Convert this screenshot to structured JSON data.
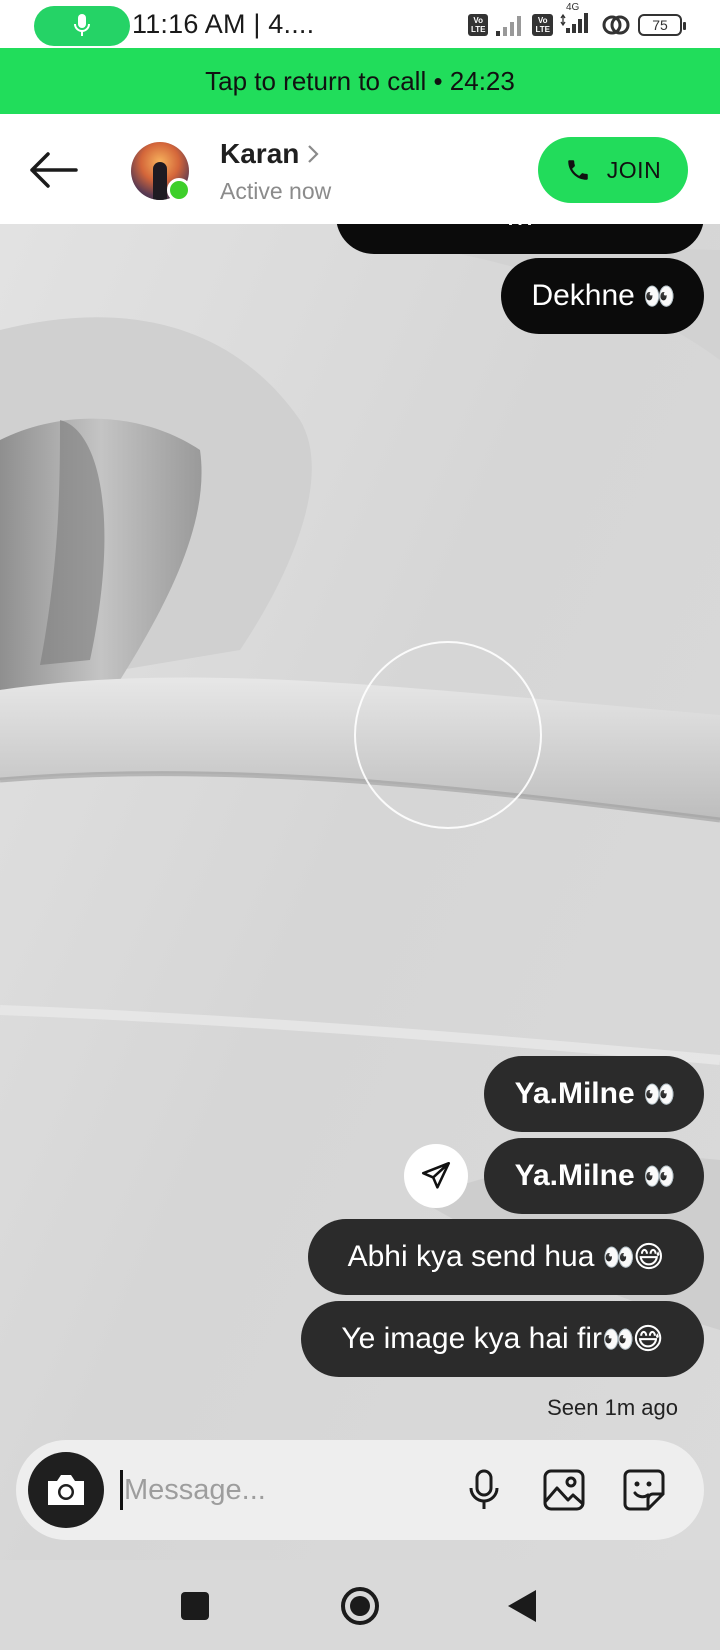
{
  "status_bar": {
    "time": "11:16 AM | 4....",
    "lte_badge": "Vo\nLTE",
    "network_label": "4G",
    "battery": "75",
    "icons": [
      "mic-icon",
      "volte-icon",
      "signal-icon",
      "volte-icon",
      "signal-4g-icon",
      "hotspot-icon",
      "battery-icon"
    ]
  },
  "call_banner": {
    "text": "Tap to return to call • 24:23",
    "color": "#21dd5b"
  },
  "header": {
    "contact_name": "Karan",
    "status": "Active now",
    "join_label": "JOIN",
    "join_color": "#22dc5b",
    "online_color": "#3ecf2a"
  },
  "messages": {
    "partial_top": "…",
    "dekhne": "Dekhne",
    "ya_milne_1": "Ya.Milne",
    "ya_milne_2": "Ya.Milne",
    "abhi": "Abhi kya send hua",
    "ye_image": "Ye image kya hai fir",
    "eyes": "👀",
    "sweat": "😅",
    "seen": "Seen 1m ago"
  },
  "composer": {
    "placeholder": "Message...",
    "value": "",
    "icons": [
      "camera-icon",
      "microphone-icon",
      "gallery-icon",
      "sticker-icon"
    ]
  },
  "nav_bar": {
    "icons": [
      "recents-icon",
      "home-icon",
      "back-icon"
    ]
  }
}
